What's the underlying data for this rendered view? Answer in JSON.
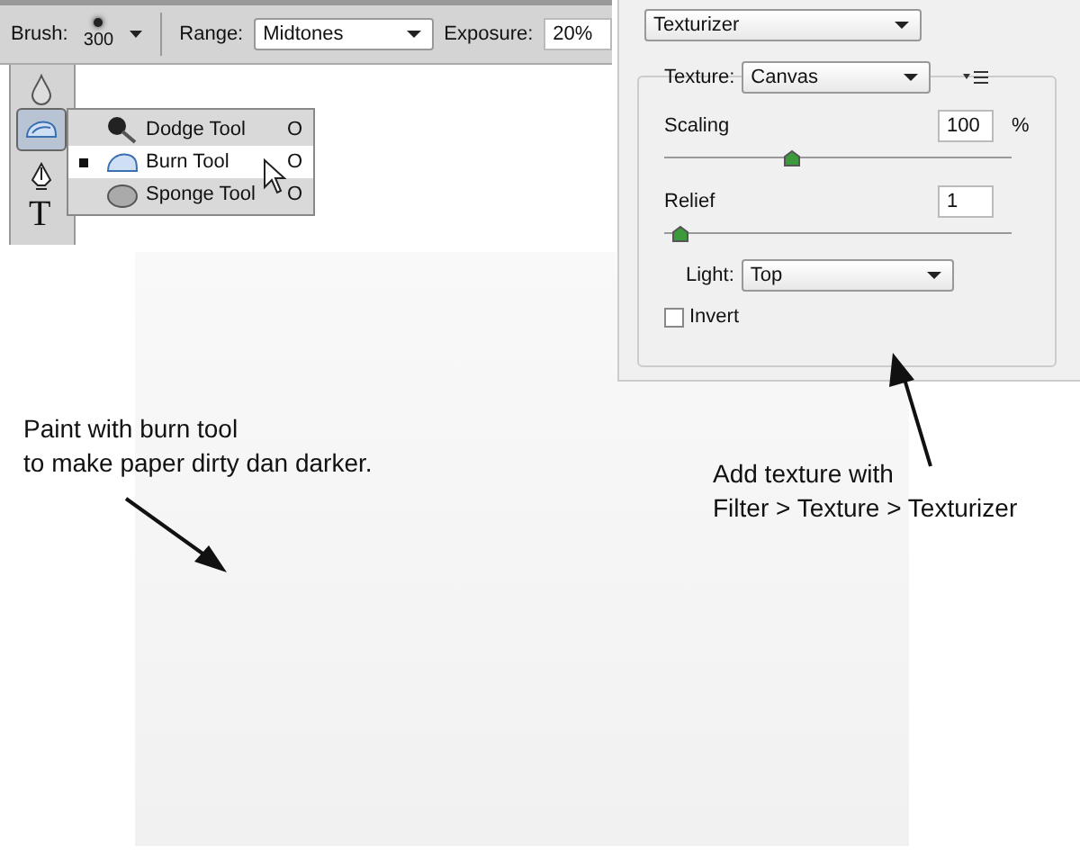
{
  "options_bar": {
    "brush_label": "Brush:",
    "brush_size": "300",
    "range_label": "Range:",
    "range_value": "Midtones",
    "exposure_label": "Exposure:",
    "exposure_value": "20%"
  },
  "tools_panel": {
    "type_tool": "T"
  },
  "tool_flyout": [
    {
      "kind": "dodge",
      "label": "Dodge Tool",
      "shortcut": "O",
      "selected": false
    },
    {
      "kind": "burn",
      "label": "Burn Tool",
      "shortcut": "O",
      "selected": true
    },
    {
      "kind": "sponge",
      "label": "Sponge Tool",
      "shortcut": "O",
      "selected": false
    }
  ],
  "filter_panel": {
    "filter": "Texturizer",
    "texture_label": "Texture:",
    "texture": "Canvas",
    "scaling_label": "Scaling",
    "scaling_value": "100",
    "scaling_unit": "%",
    "scaling_slider": {
      "level": 0.34
    },
    "relief_label": "Relief",
    "relief_value": "1",
    "relief_slider": {
      "level": 0.02
    },
    "light_label": "Light:",
    "light": "Top",
    "invert_label": "Invert",
    "invert_checked": false
  },
  "annotations": [
    {
      "lines": [
        "Paint with burn tool",
        "to make paper dirty dan darker."
      ]
    },
    {
      "lines": [
        "Add texture with",
        "Filter > Texture > Texturizer"
      ]
    }
  ]
}
